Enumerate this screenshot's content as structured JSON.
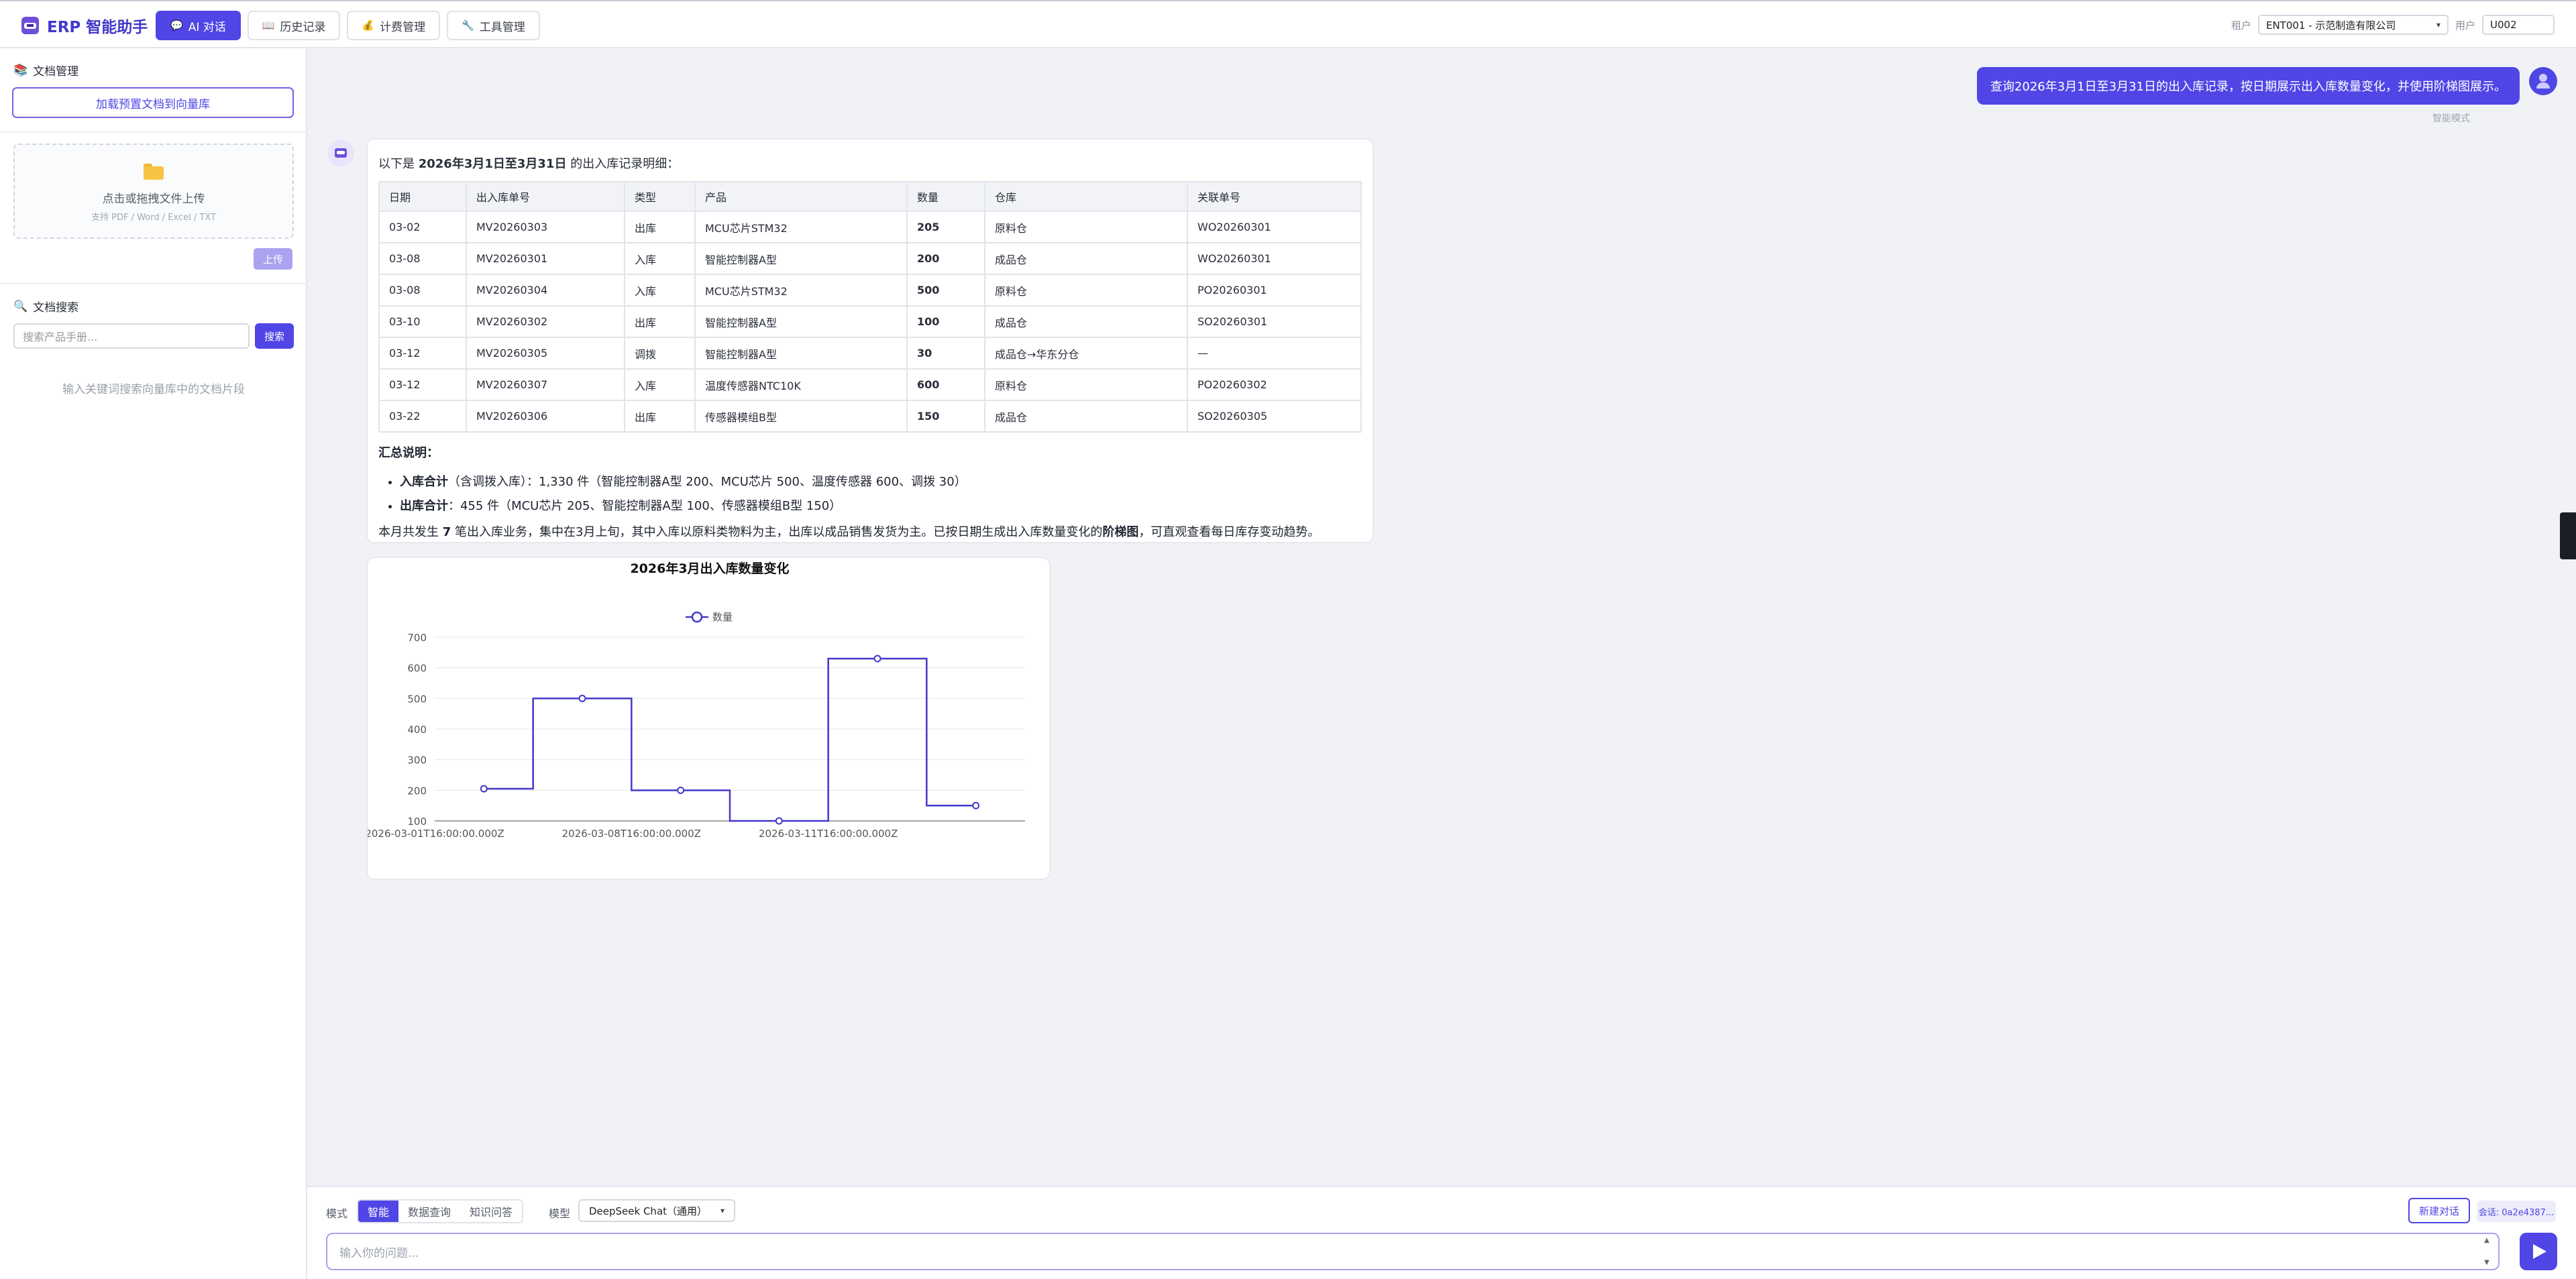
{
  "app": {
    "title": "ERP 智能助手"
  },
  "nav": {
    "tabs": [
      {
        "label": "AI 对话",
        "icon": "chat-bubble-icon",
        "active": true
      },
      {
        "label": "历史记录",
        "icon": "book-icon",
        "active": false
      },
      {
        "label": "计费管理",
        "icon": "money-bag-icon",
        "active": false
      },
      {
        "label": "工具管理",
        "icon": "wrench-icon",
        "active": false
      }
    ],
    "tenant_label": "租户",
    "tenant_value": "ENT001 - 示范制造有限公司",
    "user_label": "用户",
    "user_value": "U002"
  },
  "sidebar": {
    "doc_manage_title": "文档管理",
    "load_button": "加载预置文档到向量库",
    "dropzone_main": "点击或拖拽文件上传",
    "dropzone_sub": "支持 PDF / Word / Excel / TXT",
    "upload_button": "上传",
    "doc_search_title": "文档搜索",
    "search_placeholder": "搜索产品手册...",
    "search_button": "搜索",
    "search_hint": "输入关键词搜索向量库中的文档片段"
  },
  "chat": {
    "user_message": "查询2026年3月1日至3月31日的出入库记录，按日期展示出入库数量变化，并使用阶梯图展示。",
    "user_mode_note": "智能模式",
    "answer": {
      "intro_prefix": "以下是 ",
      "intro_bold": "2026年3月1日至3月31日",
      "intro_suffix": " 的出入库记录明细：",
      "table": {
        "headers": [
          "日期",
          "出入库单号",
          "类型",
          "产品",
          "数量",
          "仓库",
          "关联单号"
        ],
        "rows": [
          [
            "03-02",
            "MV20260303",
            "出库",
            "MCU芯片STM32",
            "205",
            "原料仓",
            "WO20260301"
          ],
          [
            "03-08",
            "MV20260301",
            "入库",
            "智能控制器A型",
            "200",
            "成品仓",
            "WO20260301"
          ],
          [
            "03-08",
            "MV20260304",
            "入库",
            "MCU芯片STM32",
            "500",
            "原料仓",
            "PO20260301"
          ],
          [
            "03-10",
            "MV20260302",
            "出库",
            "智能控制器A型",
            "100",
            "成品仓",
            "SO20260301"
          ],
          [
            "03-12",
            "MV20260305",
            "调拨",
            "智能控制器A型",
            "30",
            "成品仓→华东分仓",
            "—"
          ],
          [
            "03-12",
            "MV20260307",
            "入库",
            "温度传感器NTC10K",
            "600",
            "原料仓",
            "PO20260302"
          ],
          [
            "03-22",
            "MV20260306",
            "出库",
            "传感器模组B型",
            "150",
            "成品仓",
            "SO20260305"
          ]
        ]
      },
      "summary_title": "汇总说明：",
      "summary_items": [
        {
          "label": "入库合计",
          "text": "（含调拨入库）：1,330 件（智能控制器A型 200、MCU芯片 500、温度传感器 600、调拨 30）"
        },
        {
          "label": "出库合计",
          "text": "：455 件（MCU芯片 205、智能控制器A型 100、传感器模组B型 150）"
        }
      ],
      "conclusion_prefix": "本月共发生 ",
      "conclusion_count": "7",
      "conclusion_mid": " 笔出入库业务，集中在3月上旬，其中入库以原料类物料为主，出库以成品销售发货为主。已按日期生成出入库数量变化的",
      "conclusion_bold": "阶梯图",
      "conclusion_suffix": "，可直观查看每日库存变动趋势。"
    }
  },
  "chart_data": {
    "type": "line",
    "step": true,
    "title": "2026年3月出入库数量变化",
    "legend": "数量",
    "legend_position": "top-center",
    "x": [
      "2026-03-01T16:00:00.000Z",
      "2026-03-07T16:00:00.000Z",
      "2026-03-08T16:00:00.000Z",
      "2026-03-09T16:00:00.000Z",
      "2026-03-10T16:00:00.000Z",
      "2026-03-11T16:00:00.000Z",
      "2026-03-21T16:00:00.000Z"
    ],
    "xticks": [
      "2026-03-01T16:00:00.000Z",
      "2026-03-08T16:00:00.000Z",
      "2026-03-11T16:00:00.000Z"
    ],
    "series": [
      {
        "name": "数量",
        "values": [
          205,
          500,
          200,
          100,
          630,
          150
        ],
        "color": "#4338ca"
      }
    ],
    "ylim": [
      100,
      700
    ],
    "yticks": [
      100,
      200,
      300,
      400,
      500,
      600,
      700
    ],
    "grid": true
  },
  "bottom": {
    "mode_label": "模式",
    "modes": [
      {
        "label": "智能",
        "active": true
      },
      {
        "label": "数据查询",
        "active": false
      },
      {
        "label": "知识问答",
        "active": false
      }
    ],
    "model_label": "模型",
    "model_value": "DeepSeek Chat（通用）",
    "new_chat": "新建对话",
    "session": "会话: 0a2e4387...",
    "input_placeholder": "输入你的问题..."
  },
  "colors": {
    "accent": "#4f46e5"
  }
}
